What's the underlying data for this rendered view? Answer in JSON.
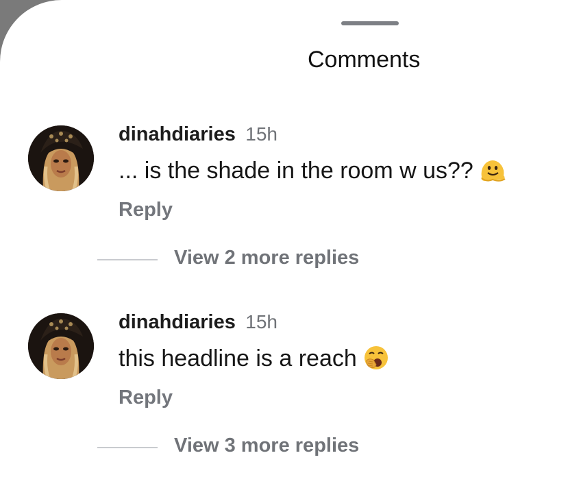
{
  "sheet": {
    "title": "Comments"
  },
  "comments": [
    {
      "username": "dinahdiaries",
      "time": "15h",
      "text": "... is the shade in the room w us??",
      "emoji": "melting-face-emoji",
      "reply_label": "Reply",
      "view_more_label": "View 2 more replies"
    },
    {
      "username": "dinahdiaries",
      "time": "15h",
      "text": "this headline is a reach",
      "emoji": "yawning-face-emoji",
      "reply_label": "Reply",
      "view_more_label": "View 3 more replies"
    }
  ],
  "colors": {
    "background_dim": "#7a7a7a",
    "sheet": "#ffffff",
    "secondary_text": "#707378",
    "emoji_yellow": "#f7c23a"
  }
}
